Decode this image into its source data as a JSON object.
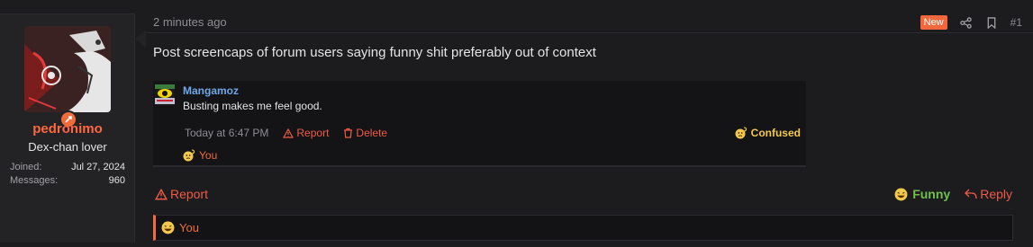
{
  "user": {
    "name": "pedronimo",
    "title": "Dex-chan lover",
    "joined_label": "Joined:",
    "joined_value": "Jul 27, 2024",
    "messages_label": "Messages:",
    "messages_value": "960"
  },
  "post": {
    "time": "2 minutes ago",
    "new_badge": "New",
    "number": "#1",
    "text": "Post screencaps of forum users saying funny shit preferably out of context"
  },
  "embed": {
    "username": "Mangamoz",
    "message": "Busting makes me feel good.",
    "time": "Today at 6:47 PM",
    "report": "Report",
    "delete": "Delete",
    "reaction": "Confused",
    "you": "You"
  },
  "actions": {
    "report": "Report",
    "funny": "Funny",
    "reply": "Reply"
  },
  "reactions_bar": {
    "you": "You"
  },
  "colors": {
    "accent": "#f26b3a",
    "username": "#ff6740",
    "link": "#6ea7e8",
    "funny": "#6fbf4d",
    "confused": "#f2c94c"
  },
  "icons": {
    "share": "share-icon",
    "bookmark": "bookmark-icon",
    "report": "warning-triangle-icon",
    "delete": "trash-icon",
    "reply": "reply-arrow-icon",
    "funny": "laughing-emoji-icon",
    "confused": "confused-emoji-icon"
  }
}
